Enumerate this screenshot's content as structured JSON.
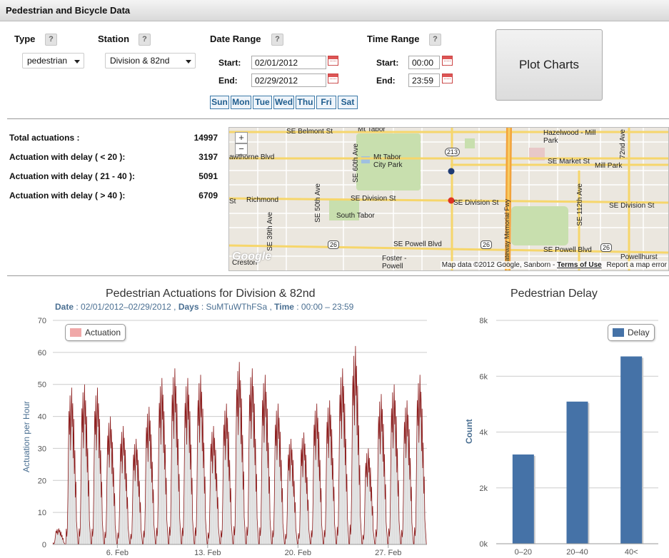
{
  "window": {
    "title": "Pedestrian and Bicycle Data"
  },
  "form": {
    "type_label": "Type",
    "type_value": "pedestrian",
    "station_label": "Station",
    "station_value": "Division & 82nd",
    "date_label": "Date Range",
    "time_label": "Time Range",
    "help": "?",
    "start_label": "Start:",
    "end_label": "End:",
    "date_start": "02/01/2012",
    "date_end": "02/29/2012",
    "time_start": "00:00",
    "time_end": "23:59",
    "days": [
      "Sun",
      "Mon",
      "Tue",
      "Wed",
      "Thu",
      "Fri",
      "Sat"
    ],
    "plot_button": "Plot Charts"
  },
  "stats": [
    {
      "label": "Total actuations :",
      "value": "14997"
    },
    {
      "label": "Actuation with delay ( < 20 ):",
      "value": "3197"
    },
    {
      "label": "Actuation with delay ( 21 - 40 ):",
      "value": "5091"
    },
    {
      "label": "Actuation with delay ( > 40 ):",
      "value": "6709"
    }
  ],
  "map": {
    "zoom_in": "+",
    "zoom_out": "−",
    "labels": {
      "belmont": "SE Belmont St",
      "mt_tabor_top": "Mt Tabor",
      "hazelwood": "Hazelwood - Mill Park",
      "ave72": "72nd Ave",
      "hawthorne": "awthorne Blvd",
      "ave60": "SE 60th Ave",
      "mt_tabor_park": "Mt Tabor City Park",
      "hwy213": "213",
      "market": "SE Market St",
      "mill_park": "Mill Park",
      "richmond": "Richmond",
      "st": "St",
      "ave50": "SE 50th Ave",
      "division1": "SE Division St",
      "division2": "SE Division St",
      "division3": "SE Division St",
      "south_tabor": "South Tabor",
      "ave112": "SE 112th Ave",
      "ave39": "SE 39th Ave",
      "hwy26a": "26",
      "powell1": "SE Powell Blvd",
      "hwy26b": "26",
      "hwy26c": "26",
      "memorial": "Gateway Memorial Fwy",
      "powell2": "SE Powell Blvd",
      "foster": "Foster - Powell",
      "creston": "Creston",
      "powellhurst": "Powellhurst"
    },
    "logo": "Google",
    "attribution": "Map data ©2012 Google, Sanborn - ",
    "terms": "Terms of Use",
    "report": "Report a map error"
  },
  "colors": {
    "bar": "#4572a7",
    "line": "#8b1a1a",
    "legend_actuation": "#f0a8a8",
    "axis_text": "#4a6f92"
  },
  "chart_data": [
    {
      "type": "line",
      "title": "Pedestrian Actuations for Division & 82nd",
      "subtitle": {
        "date_label": "Date",
        "date_value": ": 02/01/2012–02/29/2012 ,",
        "days_label": "Days",
        "days_value": ": SuMTuWThFSa ,",
        "time_label": "Time",
        "time_value": ": 00:00 – 23:59"
      },
      "ylabel": "Actuation per Hour",
      "ylim": [
        0,
        70
      ],
      "yticks": [
        0,
        10,
        20,
        30,
        40,
        50,
        60,
        70
      ],
      "xticks": [
        "6. Feb",
        "13. Feb",
        "20. Feb",
        "27. Feb"
      ],
      "legend": "top-left",
      "series": [
        {
          "name": "Actuation",
          "daily_peak": [
            5,
            49,
            50,
            49,
            40,
            37,
            33,
            43,
            52,
            55,
            52,
            53,
            37,
            44,
            57,
            55,
            53,
            44,
            33,
            35,
            44,
            45,
            55,
            62,
            30,
            47,
            50,
            45,
            53
          ]
        }
      ]
    },
    {
      "type": "bar",
      "title": "Pedestrian Delay",
      "categories": [
        "0–20",
        "20–40",
        "40<"
      ],
      "series": [
        {
          "name": "Delay",
          "values": [
            3197,
            5091,
            6709
          ]
        }
      ],
      "ylabel": "Count",
      "ylim": [
        0,
        8000
      ],
      "yticks": [
        "0k",
        "2k",
        "4k",
        "6k",
        "8k"
      ],
      "legend": "top-right"
    }
  ]
}
